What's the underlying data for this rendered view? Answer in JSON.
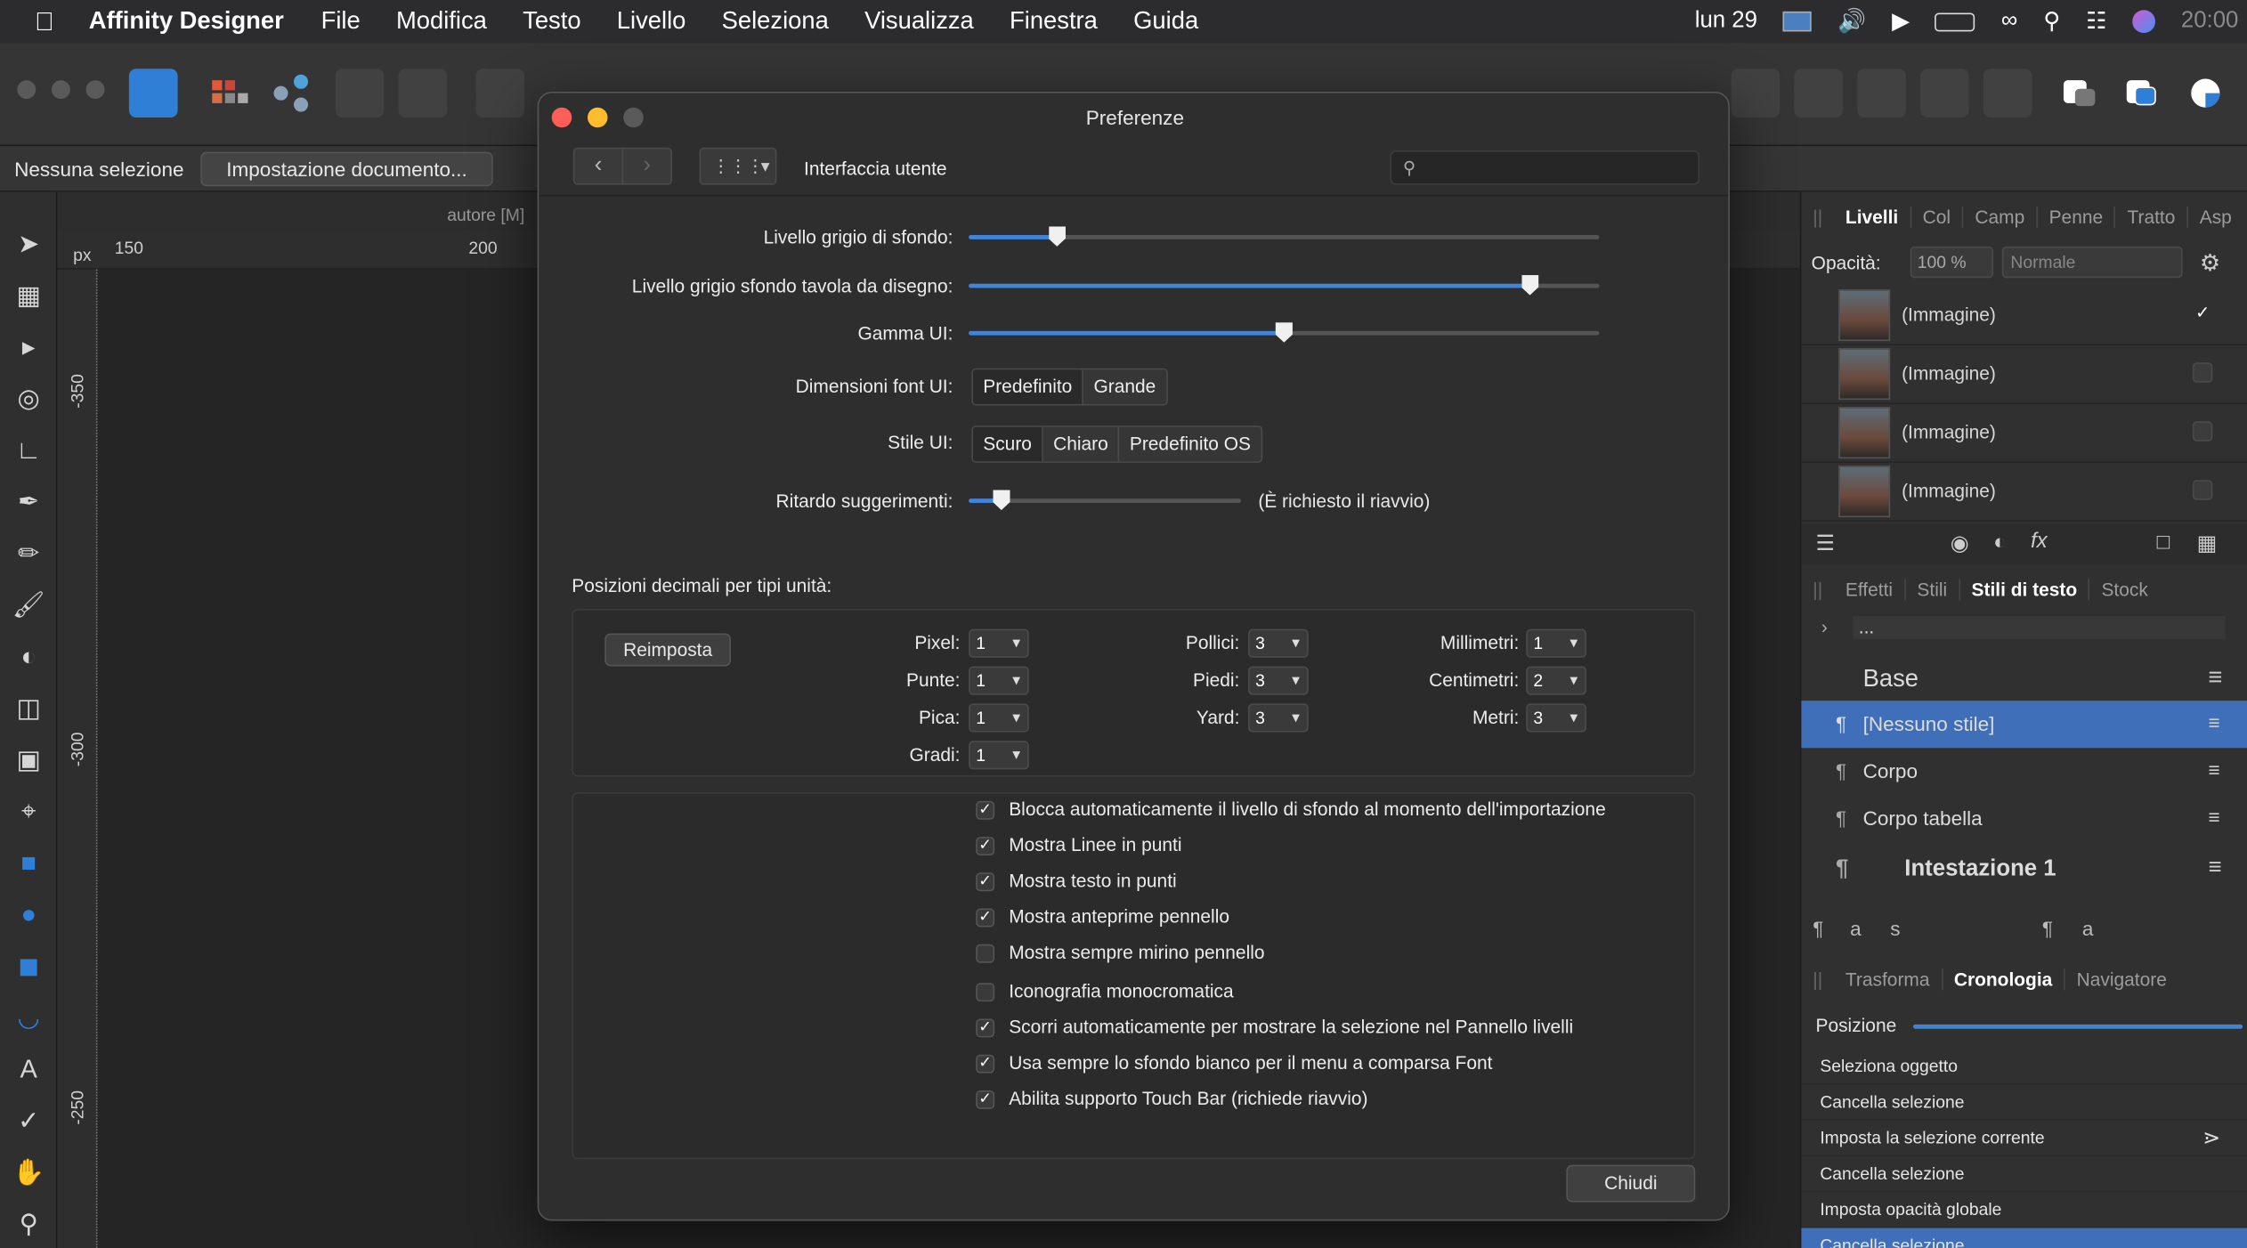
{
  "menubar": {
    "app_name": "Affinity Designer",
    "items": [
      "File",
      "Modifica",
      "Testo",
      "Livello",
      "Seleziona",
      "Visualizza",
      "Finestra",
      "Guida"
    ],
    "date": "lun 29",
    "time": "20:00"
  },
  "context": {
    "no_selection": "Nessuna selezione",
    "doc_setup": "Impostazione documento..."
  },
  "canvas": {
    "tab_text": "autore [M]",
    "ruler_unit": "px",
    "hruler_ticks": [
      "150",
      "200"
    ],
    "vruler_ticks": [
      "-350",
      "-300",
      "-250"
    ]
  },
  "dialog": {
    "title": "Preferenze",
    "section": "Interfaccia utente",
    "rows": {
      "bg_gray": {
        "label": "Livello grigio di sfondo:",
        "value": 0.14
      },
      "artboard_gray": {
        "label": "Livello grigio sfondo tavola da disegno:",
        "value": 0.89
      },
      "gamma": {
        "label": "Gamma UI:",
        "value": 0.5
      },
      "font_size": {
        "label": "Dimensioni font UI:",
        "options": [
          "Predefinito",
          "Grande"
        ],
        "selected": "Predefinito"
      },
      "ui_style": {
        "label": "Stile UI:",
        "options": [
          "Scuro",
          "Chiaro",
          "Predefinito OS"
        ],
        "selected": "Scuro"
      },
      "tooltip_delay": {
        "label": "Ritardo suggerimenti:",
        "value": 0.12,
        "note": "(È richiesto il riavvio)"
      }
    },
    "decimal_title": "Posizioni decimali per tipi unità:",
    "reset_label": "Reimposta",
    "units": [
      {
        "label": "Pixel:",
        "value": "1"
      },
      {
        "label": "Punte:",
        "value": "1"
      },
      {
        "label": "Pica:",
        "value": "1"
      },
      {
        "label": "Gradi:",
        "value": "1"
      },
      {
        "label": "Pollici:",
        "value": "3"
      },
      {
        "label": "Piedi:",
        "value": "3"
      },
      {
        "label": "Yard:",
        "value": "3"
      },
      {
        "label": "Millimetri:",
        "value": "1"
      },
      {
        "label": "Centimetri:",
        "value": "2"
      },
      {
        "label": "Metri:",
        "value": "3"
      }
    ],
    "checkboxes": [
      {
        "label": "Blocca automaticamente il livello di sfondo al momento dell'importazione",
        "checked": true
      },
      {
        "label": "Mostra Linee in punti",
        "checked": true
      },
      {
        "label": "Mostra testo in punti",
        "checked": true
      },
      {
        "label": "Mostra anteprime pennello",
        "checked": true
      },
      {
        "label": "Mostra sempre mirino pennello",
        "checked": false
      },
      {
        "label": "Iconografia monocromatica",
        "checked": false
      },
      {
        "label": "Scorri automaticamente per mostrare la selezione nel Pannello livelli",
        "checked": true
      },
      {
        "label": "Usa sempre lo sfondo bianco per il menu a comparsa Font",
        "checked": true
      },
      {
        "label": "Abilita supporto Touch Bar (richiede riavvio)",
        "checked": true
      }
    ],
    "close_label": "Chiudi"
  },
  "layers_panel": {
    "tabs": [
      "Livelli",
      "Col",
      "Camp",
      "Penne",
      "Tratto",
      "Asp"
    ],
    "opacity_label": "Opacità:",
    "opacity_value": "100 %",
    "blend_mode": "Normale",
    "layers": [
      {
        "name": "(Immagine)",
        "visible": true
      },
      {
        "name": "(Immagine)",
        "visible": false
      },
      {
        "name": "(Immagine)",
        "visible": false
      },
      {
        "name": "(Immagine)",
        "visible": false
      }
    ]
  },
  "styles_panel": {
    "tabs": [
      "Effetti",
      "Stili",
      "Stili di testo",
      "Stock"
    ],
    "ellipsis": "...",
    "group": "Base",
    "styles": [
      "[Nessuno stile]",
      "Corpo",
      "Corpo tabella",
      "Intestazione 1"
    ]
  },
  "history_panel": {
    "tabs": [
      "Trasforma",
      "Cronologia",
      "Navigatore"
    ],
    "position_label": "Posizione",
    "items": [
      "Seleziona oggetto",
      "Cancella selezione",
      "Imposta la selezione corrente",
      "Cancella selezione",
      "Imposta opacità globale",
      "Cancella selezione"
    ]
  },
  "colors": {
    "accent": "#3f84d8",
    "selected_row": "#3f6fb8",
    "close_red": "#ff5f57",
    "min_yellow": "#febc2e"
  }
}
